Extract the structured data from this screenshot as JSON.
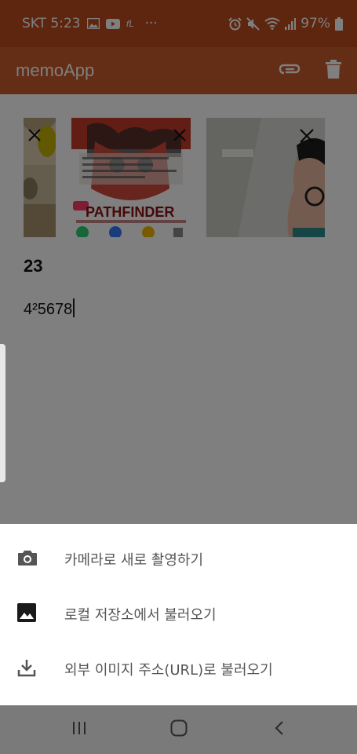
{
  "status_bar": {
    "carrier_time": "SKT 5:23",
    "extra_badge": "fL",
    "more": "···",
    "battery": "97%",
    "background": "#bf4d1f"
  },
  "app_bar": {
    "title": "memoApp",
    "background": "#c95a2b"
  },
  "memo": {
    "title": "23",
    "body": "4²5678"
  },
  "thumbnails": [
    {
      "name": "partial-photo"
    },
    {
      "name": "pathfinder-screenshot",
      "caption": "PATHFINDER"
    },
    {
      "name": "selfie-photo"
    }
  ],
  "sheet": {
    "items": [
      {
        "icon": "camera-icon",
        "label": "카메라로 새로 촬영하기"
      },
      {
        "icon": "image-icon",
        "label": "로컬 저장소에서 불러오기"
      },
      {
        "icon": "download-icon",
        "label": "외부 이미지 주소(URL)로 불러오기"
      }
    ]
  }
}
